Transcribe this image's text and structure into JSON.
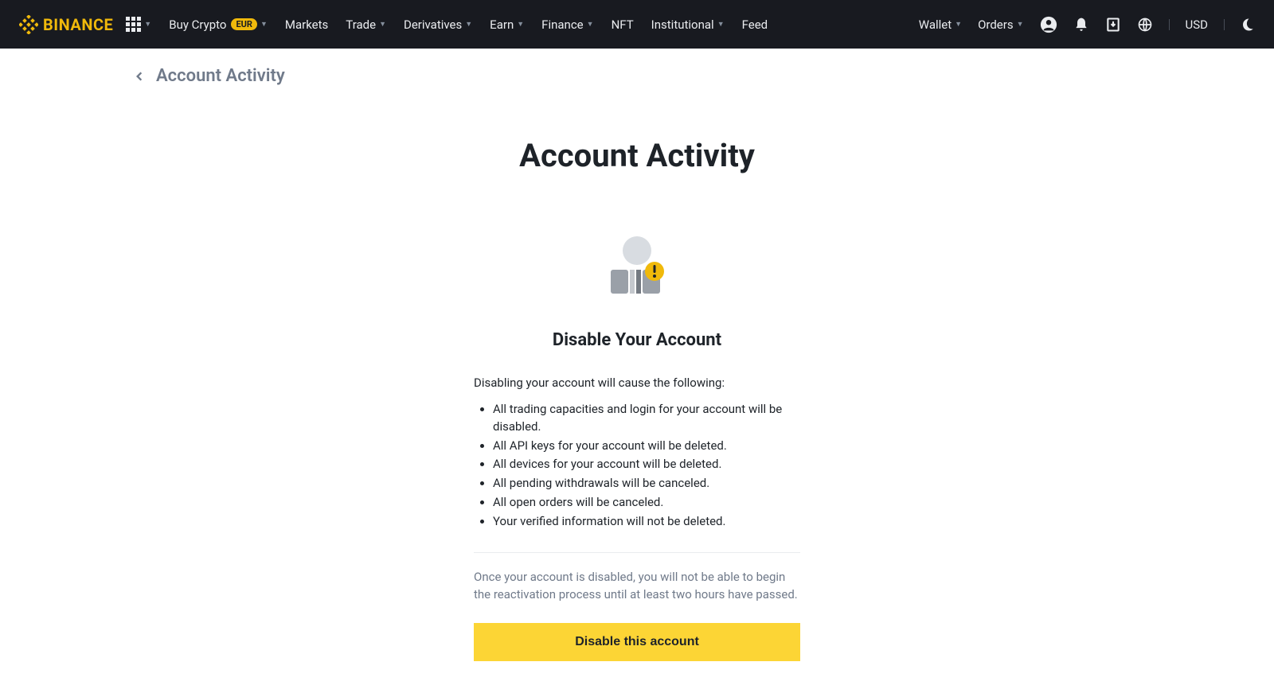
{
  "brand": "BINANCE",
  "nav": {
    "buy_crypto": "Buy Crypto",
    "eur_badge": "EUR",
    "markets": "Markets",
    "trade": "Trade",
    "derivatives": "Derivatives",
    "earn": "Earn",
    "finance": "Finance",
    "nft": "NFT",
    "institutional": "Institutional",
    "feed": "Feed",
    "wallet": "Wallet",
    "orders": "Orders",
    "currency": "USD"
  },
  "breadcrumb": "Account Activity",
  "main_title": "Account Activity",
  "section_heading": "Disable Your Account",
  "intro": "Disabling your account will cause the following:",
  "bullets": {
    "0": "All trading capacities and login for your account will be disabled.",
    "1": "All API keys for your account will be deleted.",
    "2": "All devices for your account will be deleted.",
    "3": "All pending withdrawals will be canceled.",
    "4": "All open orders will be canceled.",
    "5": "Your verified information will not be deleted."
  },
  "warning": "Once your account is disabled, you will not be able to begin the reactivation process until at least two hours have passed.",
  "disable_button": "Disable this account"
}
